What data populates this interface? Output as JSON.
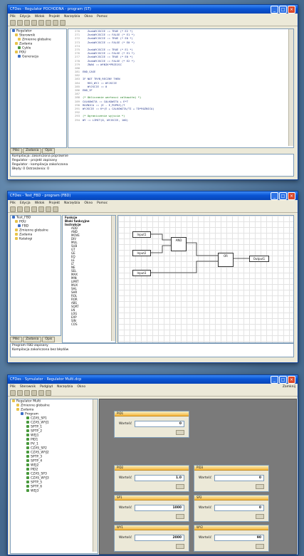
{
  "win1": {
    "title": "CFDes - Regulator POCHODNA - program (ST)",
    "menu": [
      "Plik",
      "Edycja",
      "Widok",
      "Projekt",
      "Narzędzia",
      "Okno",
      "Pomoc"
    ],
    "tree": [
      "Regulator",
      "Sterownik",
      "Zmienne globalne",
      "Zadania",
      "Cykle",
      "POU",
      "Generacja"
    ],
    "tabs": [
      "Pliki",
      "Zadania",
      "Opis"
    ],
    "messages": [
      "Kompilacja: zakończona poprawnie",
      "Regulator - projekt zapisany",
      "Regulator - kompilacja zakończona",
      "Błędy: 0 Ostrzeżenia: 0"
    ],
    "code": [
      {
        "n": "270",
        "t": "   ZnakWYJSCIE := TRUE (* E2 *)"
      },
      {
        "n": "271",
        "t": "   ZnakWYJSCIE := FALSE (* E1 *)"
      },
      {
        "n": "272",
        "t": "   ZnakWYJSCIE := TRUE (* E0 *)"
      },
      {
        "n": "273",
        "t": "   ZnakWYJSCIE := FALSE (* E0 *)"
      },
      {
        "n": "274",
        "t": ""
      },
      {
        "n": "275",
        "t": "   ZnakWYJSCIE := TRUE (* E1 *)"
      },
      {
        "n": "276",
        "t": "   ZnakWYJSCIE := FALSE (* E1 *)"
      },
      {
        "n": "277",
        "t": "   ZnakWYJSCIE := TRUE (* E0 *)"
      },
      {
        "n": "278",
        "t": "   ZnakWYJSCIE := FALSE (* E2 *)"
      },
      {
        "n": "279",
        "t": "   ZNAK := WYNIK*PRZEJSC"
      },
      {
        "n": "280",
        "t": ""
      },
      {
        "n": "281",
        "t": "END_CASE"
      },
      {
        "n": "282",
        "t": ""
      },
      {
        "n": "283",
        "t": "IF NOT TRYB_RECZNY THEN"
      },
      {
        "n": "284",
        "t": "   REG_WYJ := WYJSCIE"
      },
      {
        "n": "285",
        "t": "   WYJSCIE := 0"
      },
      {
        "n": "286",
        "t": "END_IF"
      },
      {
        "n": "287",
        "t": ""
      },
      {
        "n": "288",
        "t": "(* Obliczanie wartosci calkowitej *)",
        "c": true
      },
      {
        "n": "289",
        "t": "CALKOWITA := CALKOWITA + E*T"
      },
      {
        "n": "290",
        "t": "ROZNICA := (E - E_POPRZ)/T"
      },
      {
        "n": "291",
        "t": "WYJSCIE := K*(E + CALKOWITA/TI + TD*ROZNICA)"
      },
      {
        "n": "292",
        "t": ""
      },
      {
        "n": "293",
        "t": "(* Ograniczenie wyjscia *)",
        "c": true
      },
      {
        "n": "294",
        "t": "WY := LIMIT(0, WYJSCIE, 100)"
      }
    ]
  },
  "win2": {
    "title": "CFDes - Test_FBD - program (FBD)",
    "menu": [
      "Plik",
      "Edycja",
      "Widok",
      "Projekt",
      "Narzędzia",
      "Okno",
      "Pomoc"
    ],
    "tree": [
      "Test_FBD",
      "POU",
      "FBD",
      "Zmienne globalne",
      "Zadania",
      "Katalogi"
    ],
    "list": [
      "Funkcje",
      "Bloki funkcyjne",
      "Instrukcje",
      "ADD",
      "AND",
      "MOVE",
      "DIV",
      "MUL",
      "SUB",
      "GT",
      "GE",
      "EQ",
      "LE",
      "LT",
      "NE",
      "SEL",
      "MAX",
      "MIN",
      "LIMIT",
      "MUX",
      "SHL",
      "SHR",
      "ROL",
      "ROR",
      "ABS",
      "SQRT",
      "LN",
      "LOG",
      "EXP",
      "SIN",
      "COS"
    ],
    "tabs": [
      "Pliki",
      "Zadania",
      "Opis"
    ],
    "messages": [
      "Program FBD zapisany",
      "Kompilacja zakończona bez błędów"
    ],
    "blocks": {
      "in1": "Input1",
      "in2": "Input2",
      "in3": "Input3",
      "and": "AND",
      "or": "OR",
      "out": "Output1"
    }
  },
  "win3": {
    "title": "CFDes - Symulator - Regulator Multi.dcp",
    "menu": [
      "Plik",
      "Sterownik",
      "Podgląd",
      "Narzędzia",
      "Okno"
    ],
    "right": "Zamknij",
    "tree": [
      "Regulator Multi",
      "Zmienne globalne",
      "Zadania",
      "Program",
      "CZAS_SP1",
      "CZAS_WYJ1",
      "SPTP_1",
      "SPTP_2",
      "WEJ1",
      "PID1",
      "PV_1",
      "CZAS_SP2",
      "CZAS_WYJ2",
      "SPTP_3",
      "SPTP_4",
      "WEJ2",
      "PID2",
      "CZAS_SP3",
      "CZAS_WYJ3",
      "SPTP_5",
      "SPTP_6",
      "WEJ3"
    ],
    "dialogs": [
      {
        "t": "PID1",
        "l": "Wartość",
        "v": "0"
      },
      {
        "t": "PID2",
        "l": "Wartość",
        "v": "1.0"
      },
      {
        "t": "PID3",
        "l": "Wartość",
        "v": "0"
      },
      {
        "t": "SP1",
        "l": "Wartość",
        "v": "1000"
      },
      {
        "t": "SP2",
        "l": "Wartość",
        "v": "0"
      },
      {
        "t": "WY1",
        "l": "Wartość",
        "v": "2000"
      },
      {
        "t": "WY2",
        "l": "Wartość",
        "v": "90"
      }
    ]
  }
}
